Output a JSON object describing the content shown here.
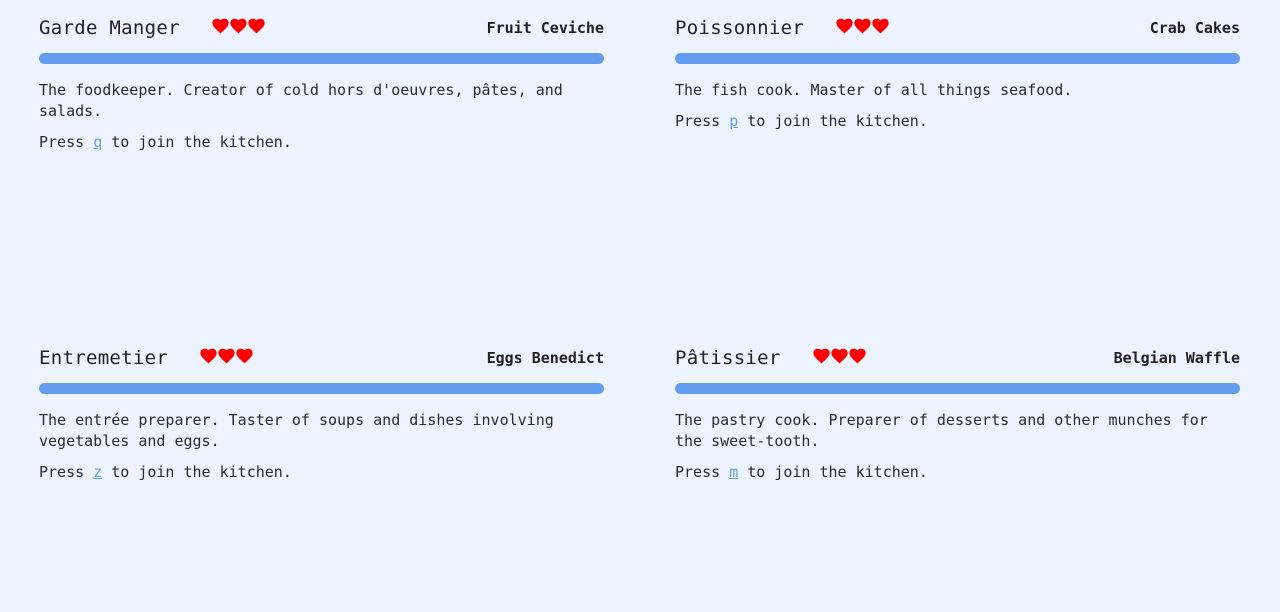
{
  "colors": {
    "background": "#edf4ff",
    "progress_bar": "#649df0",
    "heart": "#ff0000",
    "key_link": "#649df0"
  },
  "stations": [
    {
      "name": "Garde Manger",
      "hearts": 3,
      "dish": "Fruit Ceviche",
      "progress": 1.0,
      "description": "The foodkeeper. Creator of cold hors d'oeuvres, pâtes, and salads.",
      "press_prefix": "Press",
      "key": "q",
      "press_suffix": "to join the kitchen."
    },
    {
      "name": "Poissonnier",
      "hearts": 3,
      "dish": "Crab Cakes",
      "progress": 1.0,
      "description": "The fish cook. Master of all things seafood.",
      "press_prefix": "Press",
      "key": "p",
      "press_suffix": "to join the kitchen."
    },
    {
      "name": "Entremetier",
      "hearts": 3,
      "dish": "Eggs Benedict",
      "progress": 1.0,
      "description": "The entrée preparer. Taster of soups and dishes involving vegetables and eggs.",
      "press_prefix": "Press",
      "key": "z",
      "press_suffix": "to join the kitchen."
    },
    {
      "name": "Pâtissier",
      "hearts": 3,
      "dish": "Belgian Waffle",
      "progress": 1.0,
      "description": "The pastry cook. Preparer of desserts and other munches for the sweet-tooth.",
      "press_prefix": "Press",
      "key": "m",
      "press_suffix": "to join the kitchen."
    }
  ]
}
